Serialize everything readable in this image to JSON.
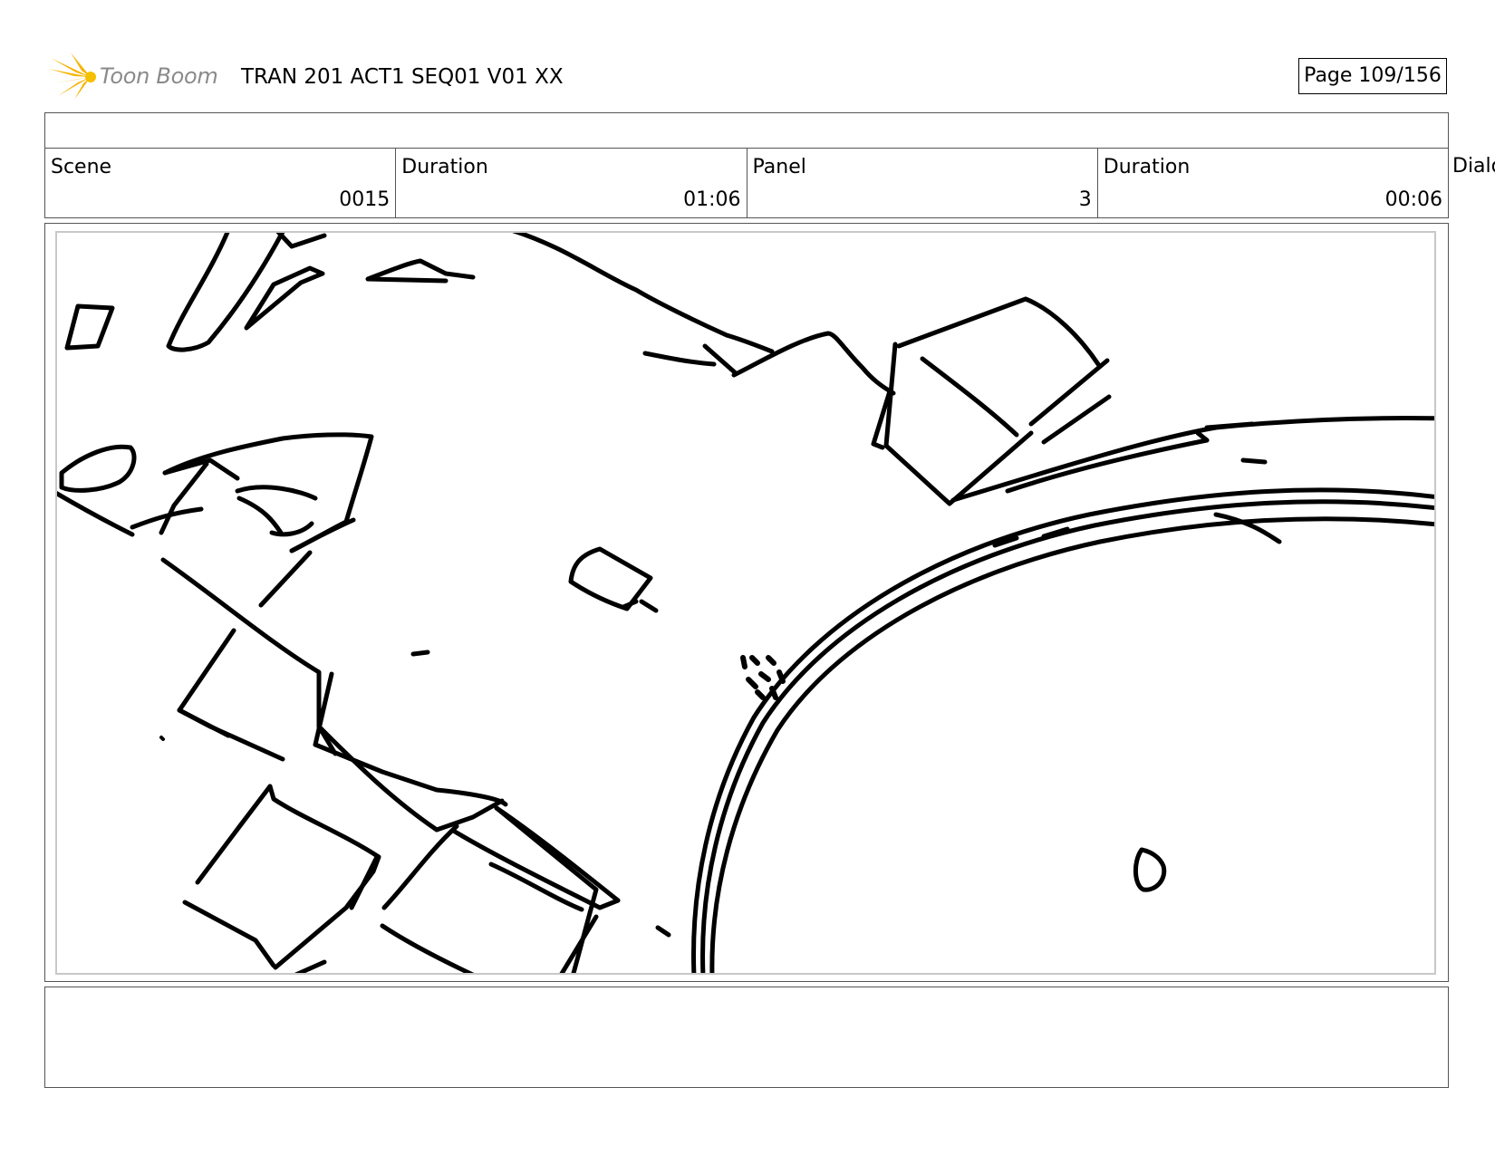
{
  "header": {
    "logo_text": "Toon Boom",
    "title": "TRAN 201 ACT1 SEQ01 V01 XX",
    "page": "Page 109/156"
  },
  "info_row": {
    "scene_label": "Scene",
    "scene_value": "0015",
    "scene_duration_label": "Duration",
    "scene_duration_value": "01:06",
    "panel_label": "Panel",
    "panel_value": "3",
    "panel_duration_label": "Duration",
    "panel_duration_value": "00:06",
    "dialog_label_partial": "Dialo"
  },
  "colors": {
    "logo_star": "#f5b400",
    "logo_text": "#8a8a8a",
    "ink": "#000000",
    "frame": "#555555",
    "safe_frame": "#c8c8c8"
  }
}
